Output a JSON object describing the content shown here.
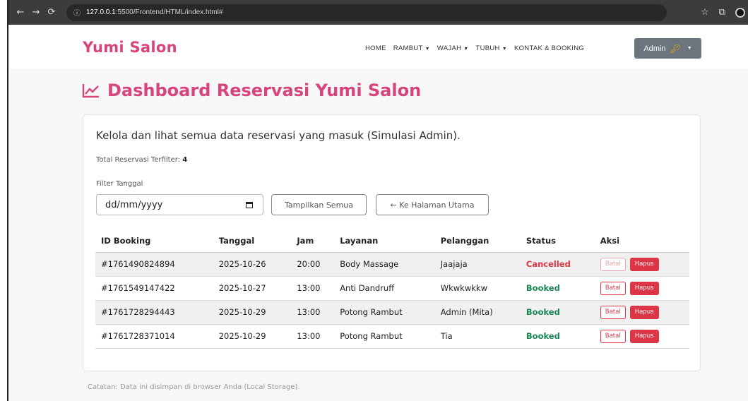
{
  "browser": {
    "url_host": "127.0.0.1",
    "url_rest": ":5500/Frontend/HTML/index.html#"
  },
  "navbar": {
    "brand": "Yumi Salon",
    "menu": [
      {
        "label": "HOME",
        "dropdown": false
      },
      {
        "label": "RAMBUT",
        "dropdown": true
      },
      {
        "label": "WAJAH",
        "dropdown": true
      },
      {
        "label": "TUBUH",
        "dropdown": true
      },
      {
        "label": "KONTAK & BOOKING",
        "dropdown": false
      }
    ],
    "admin_label": "Admin"
  },
  "page": {
    "title": "Dashboard Reservasi Yumi Salon",
    "description": "Kelola dan lihat semua data reservasi yang masuk (Simulasi Admin).",
    "total_label": "Total Reservasi Terfilter:",
    "total_value": "4",
    "filter_label": "Filter Tanggal",
    "date_placeholder": "dd/mm/yyyy",
    "btn_show_all": "Tampilkan Semua",
    "btn_home": "← Ke Halaman Utama",
    "footnote": "Catatan: Data ini disimpan di browser Anda (Local Storage)."
  },
  "table": {
    "headers": [
      "ID Booking",
      "Tanggal",
      "Jam",
      "Layanan",
      "Pelanggan",
      "Status",
      "Aksi"
    ],
    "rows": [
      {
        "id": "#1761490824894",
        "date": "2025-10-26",
        "time": "20:00",
        "service": "Body Massage",
        "customer": "Jaajaja",
        "status": "Cancelled",
        "batal": "Batal",
        "hapus": "Hapus"
      },
      {
        "id": "#1761549147422",
        "date": "2025-10-27",
        "time": "13:00",
        "service": "Anti Dandruff",
        "customer": "Wkwkwkkw",
        "status": "Booked",
        "batal": "Batal",
        "hapus": "Hapus"
      },
      {
        "id": "#1761728294443",
        "date": "2025-10-29",
        "time": "13:00",
        "service": "Potong Rambut",
        "customer": "Admin (Mita)",
        "status": "Booked",
        "batal": "Batal",
        "hapus": "Hapus"
      },
      {
        "id": "#1761728371014",
        "date": "2025-10-29",
        "time": "13:00",
        "service": "Potong Rambut",
        "customer": "Tia",
        "status": "Booked",
        "batal": "Batal",
        "hapus": "Hapus"
      }
    ]
  },
  "colors": {
    "brand": "#d6457b",
    "cancelled": "#dc3545",
    "booked": "#198754",
    "admin_button": "#6c757d"
  }
}
